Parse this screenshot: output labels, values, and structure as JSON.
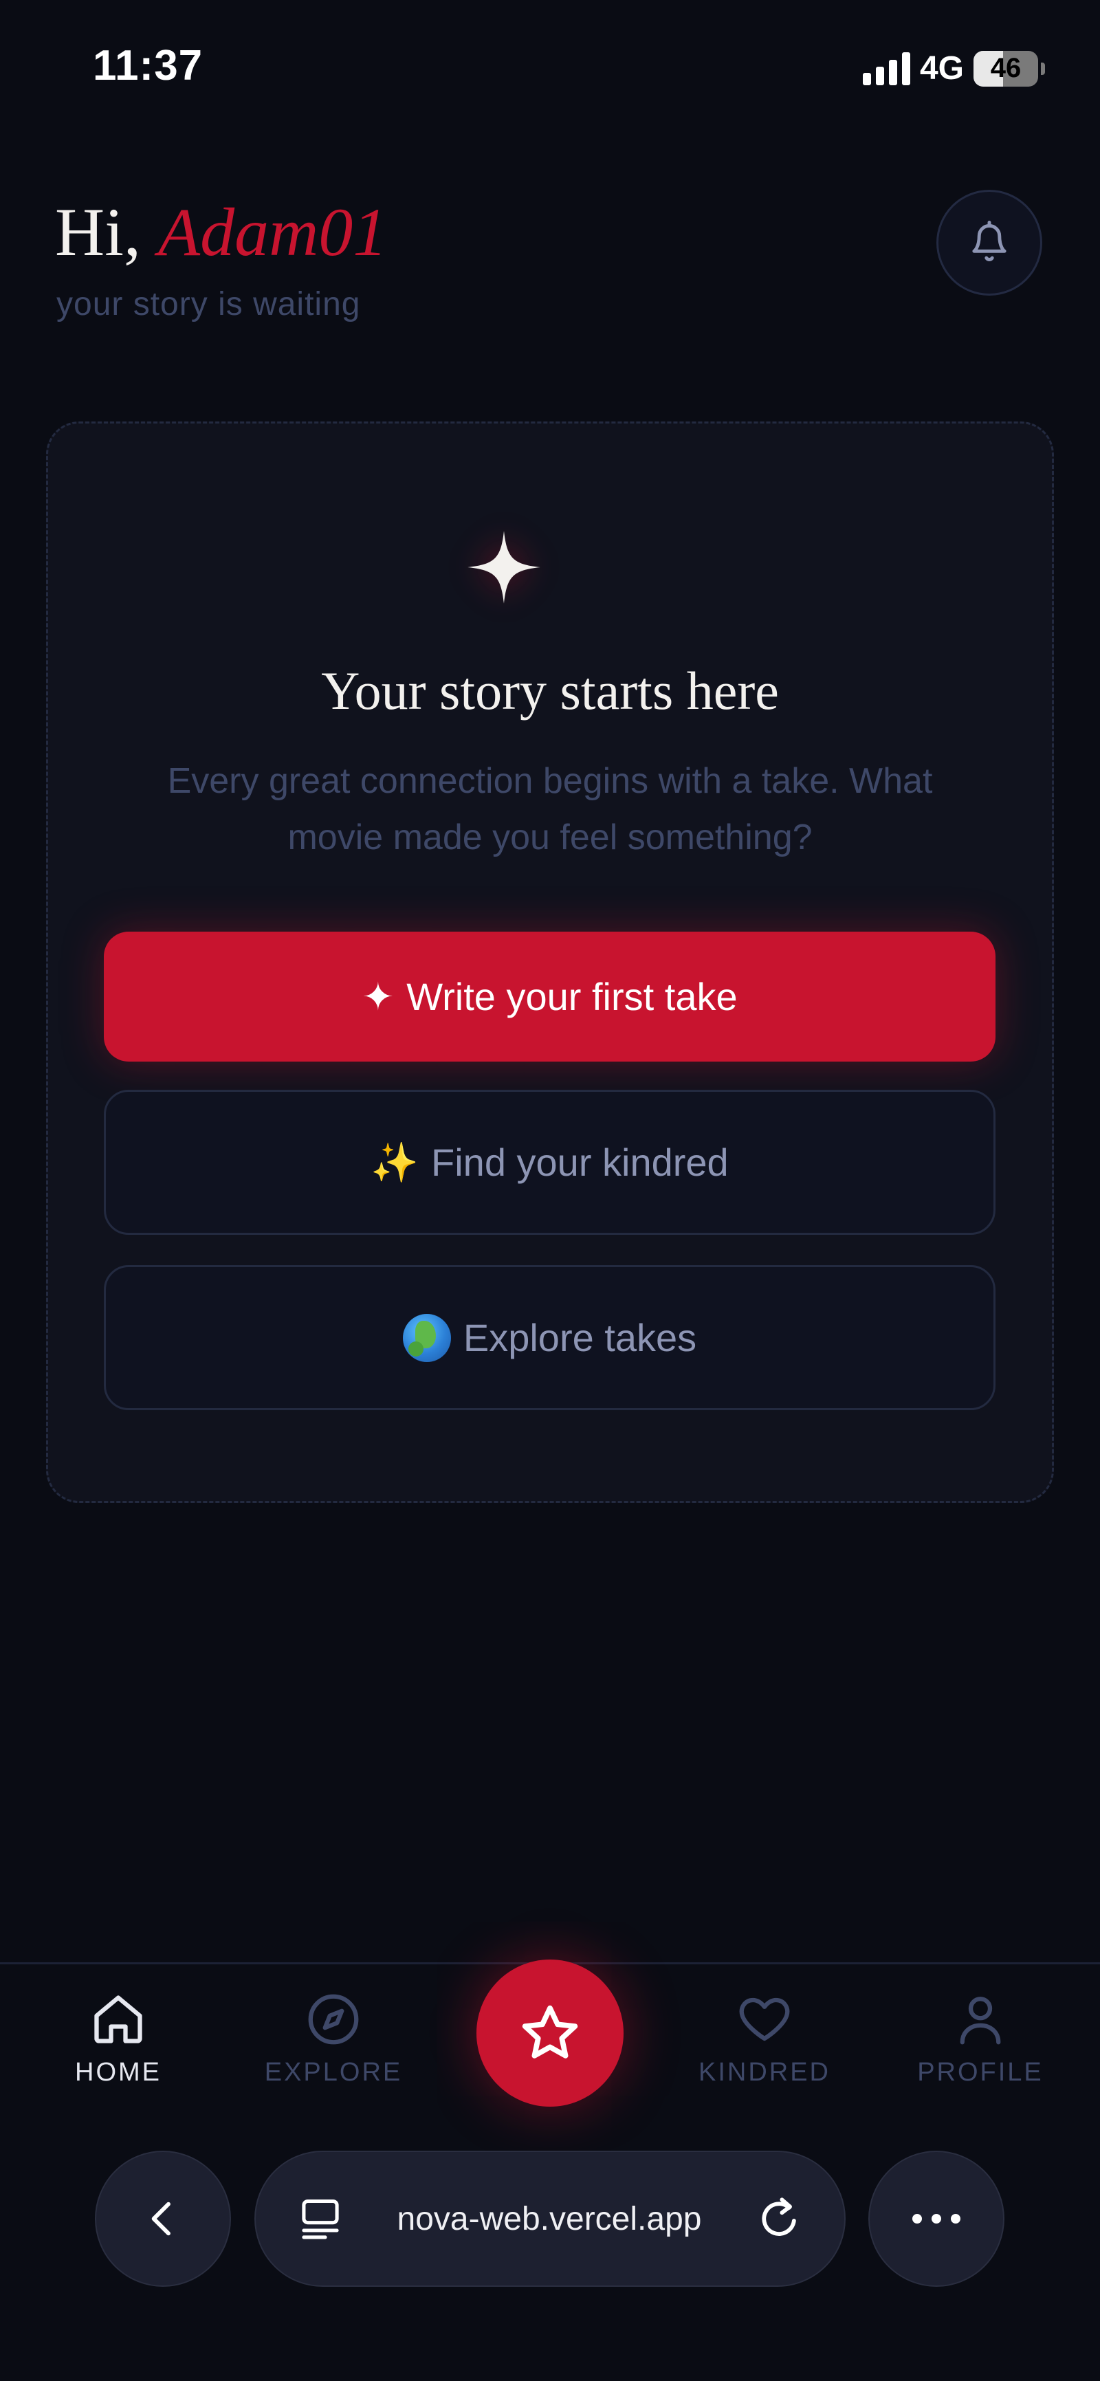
{
  "status_bar": {
    "time": "11:37",
    "network": "4G",
    "battery": "46",
    "battery_level": 0.46
  },
  "header": {
    "greeting_prefix": "Hi, ",
    "username": "Adam01",
    "subtitle": "your story is waiting",
    "notification_icon": "bell-icon"
  },
  "card": {
    "icon": "sparkle-icon",
    "title": "Your story starts here",
    "description": "Every great connection begins with a take. What movie made you feel something?",
    "primary_button": {
      "icon": "✦",
      "label": "Write your first take"
    },
    "kindred_button": {
      "icon": "✨",
      "label": "Find your kindred"
    },
    "explore_button": {
      "icon": "globe-emoji",
      "label": "Explore takes"
    }
  },
  "bottom_nav": {
    "items": [
      {
        "label": "HOME",
        "icon": "home-icon",
        "active": true
      },
      {
        "label": "EXPLORE",
        "icon": "compass-icon",
        "active": false
      },
      {
        "label": "KINDRED",
        "icon": "heart-icon",
        "active": false
      },
      {
        "label": "PROFILE",
        "icon": "person-icon",
        "active": false
      }
    ],
    "center_action_icon": "star-icon"
  },
  "browser": {
    "url": "nova-web.vercel.app",
    "back_icon": "chevron-left-icon",
    "tabs_icon": "tabs-icon",
    "reload_icon": "reload-icon",
    "more_icon": "more-icon"
  },
  "colors": {
    "background": "#0a0c14",
    "accent": "#c8142f",
    "muted_text": "#3e4868",
    "card_bg": "#10121d"
  }
}
